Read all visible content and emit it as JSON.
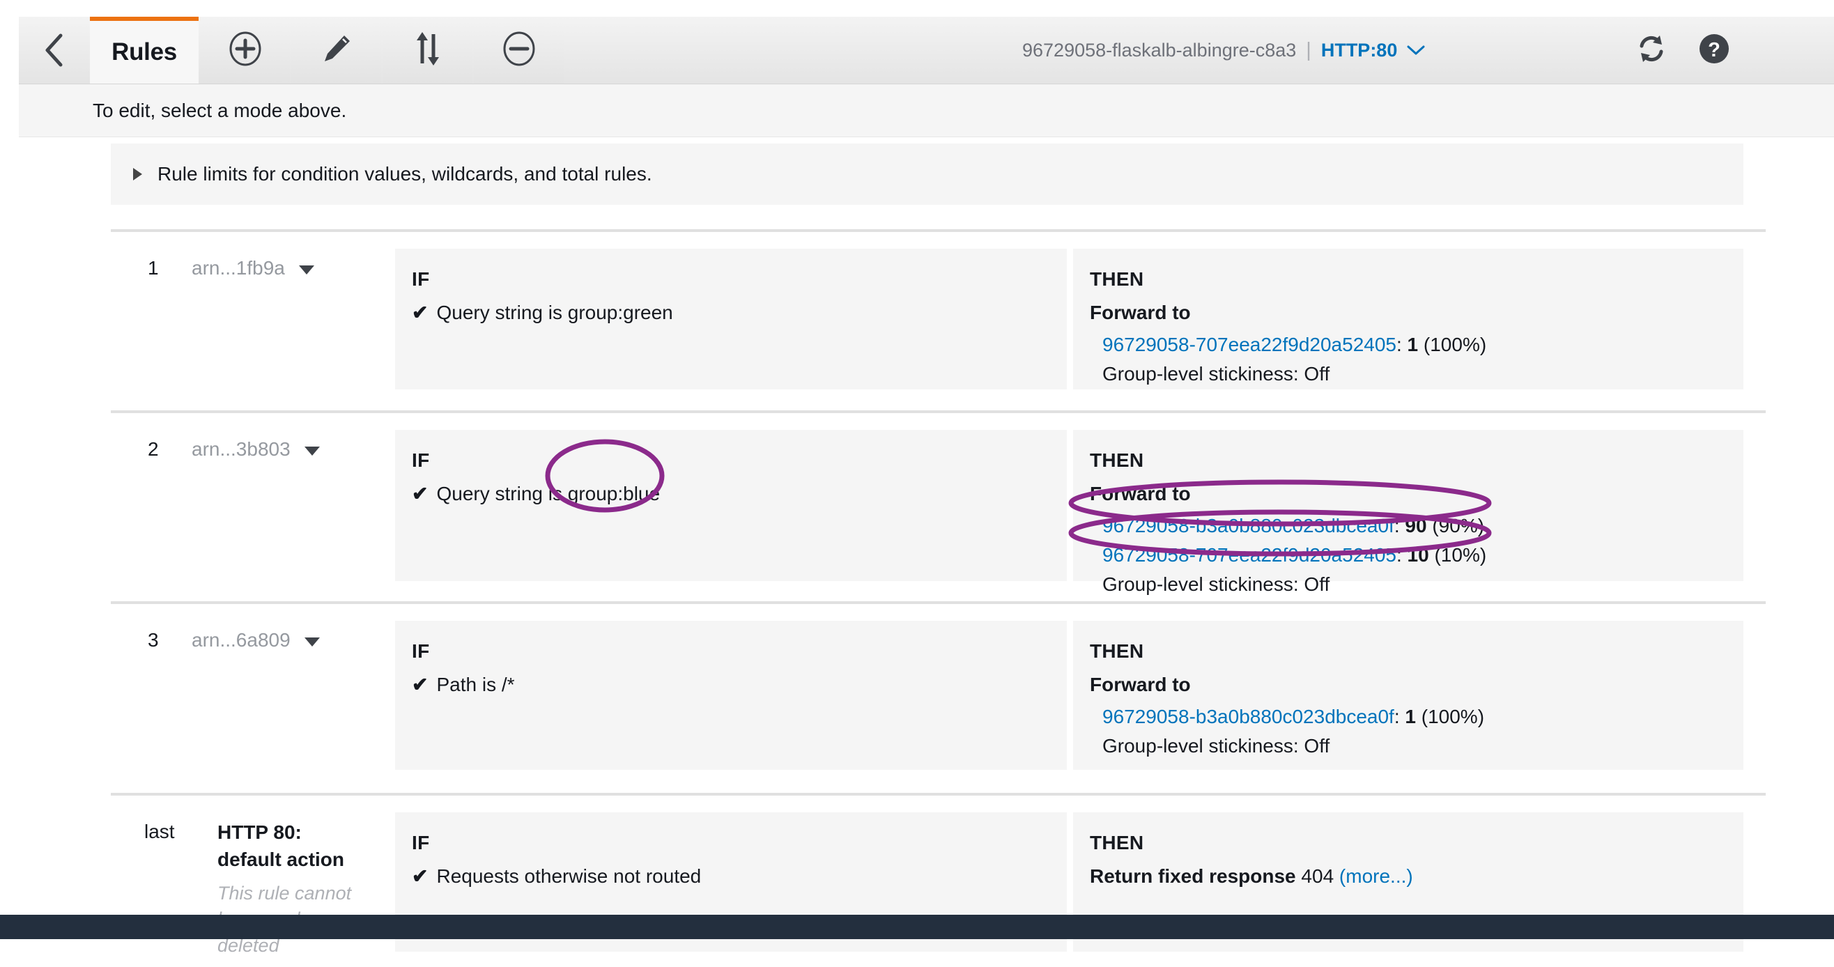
{
  "toolbar": {
    "back_icon": "chevron-left-icon",
    "tab_label": "Rules",
    "buttons": [
      {
        "name": "add-rule-button",
        "icon": "plus-circle-icon"
      },
      {
        "name": "edit-rule-button",
        "icon": "pencil-icon"
      },
      {
        "name": "reorder-rules-button",
        "icon": "sort-updown-icon"
      },
      {
        "name": "delete-rule-button",
        "icon": "minus-circle-icon"
      }
    ],
    "load_balancer_name": "96729058-flaskalb-albingre-c8a3",
    "separator": "|",
    "listener": "HTTP:80",
    "listener_caret_icon": "chevron-down-icon",
    "refresh_icon": "refresh-icon",
    "help_icon": "help-circle-icon"
  },
  "instruction": {
    "text": "To edit, select a mode above."
  },
  "limits_banner": {
    "expand_icon": "triangle-right-icon",
    "text": "Rule limits for condition values, wildcards, and total rules."
  },
  "labels": {
    "if": "IF",
    "then": "THEN",
    "forward_to": "Forward to",
    "stickiness": "Group-level stickiness: Off",
    "check_icon": "check-icon",
    "caret_icon": "caret-down-icon"
  },
  "rules": [
    {
      "index": "1",
      "arn": "arn...1fb9a",
      "condition": "Query string is group:green",
      "targets": [
        {
          "name": "96729058-707eea22f9d20a52405",
          "weight": "1",
          "percent": "(100%)"
        }
      ],
      "stickiness": "Group-level stickiness: Off"
    },
    {
      "index": "2",
      "arn": "arn...3b803",
      "condition_prefix": "Query string is",
      "condition_value": "group:blue",
      "condition": "Query string is group:blue",
      "targets": [
        {
          "name": "96729058-b3a0b880c023dbcea0f",
          "weight": "90",
          "percent": "(90%)"
        },
        {
          "name": "96729058-707eea22f9d20a52405",
          "weight": "10",
          "percent": "(10%)"
        }
      ],
      "stickiness": "Group-level stickiness: Off"
    },
    {
      "index": "3",
      "arn": "arn...6a809",
      "condition": "Path is /*",
      "targets": [
        {
          "name": "96729058-b3a0b880c023dbcea0f",
          "weight": "1",
          "percent": "(100%)"
        }
      ],
      "stickiness": "Group-level stickiness: Off"
    }
  ],
  "default_rule": {
    "index": "last",
    "title": "HTTP 80: default action",
    "note": "This rule cannot be moved or deleted",
    "condition": "Requests otherwise not routed",
    "action_label": "Return fixed response",
    "action_code": "404",
    "more_link": "(more...)"
  },
  "annotations": {
    "color": "#8B2A8B",
    "items": [
      {
        "name": "highlight-query-string-value",
        "shape": "ellipse"
      },
      {
        "name": "highlight-target-90-percent",
        "shape": "ellipse"
      },
      {
        "name": "highlight-target-10-percent",
        "shape": "ellipse"
      }
    ]
  }
}
